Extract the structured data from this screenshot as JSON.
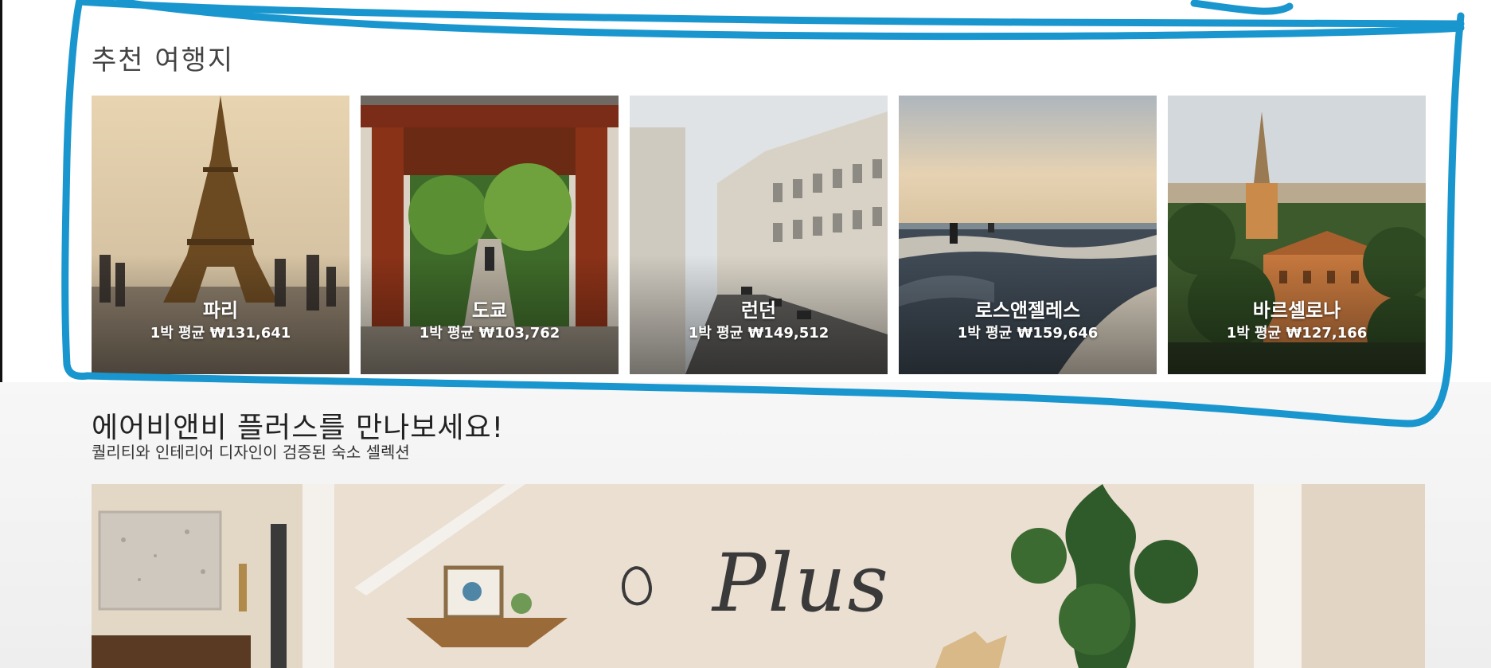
{
  "recommended": {
    "title": "추천 여행지",
    "destinations": [
      {
        "name": "파리",
        "price": "1박 평균 ₩131,641"
      },
      {
        "name": "도쿄",
        "price": "1박 평균 ₩103,762"
      },
      {
        "name": "런던",
        "price": "1박 평균 ₩149,512"
      },
      {
        "name": "로스앤젤레스",
        "price": "1박 평균 ₩159,646"
      },
      {
        "name": "바르셀로나",
        "price": "1박 평균 ₩127,166"
      }
    ]
  },
  "plus": {
    "title": "에어비앤비 플러스를 만나보세요!",
    "subtitle": "퀄리티와 인테리어 디자인이 검증된 숙소 셀렉션",
    "banner_logo_text": "Plus"
  },
  "colors": {
    "annotation_stroke": "#1a96cf",
    "text_primary": "#222222"
  }
}
